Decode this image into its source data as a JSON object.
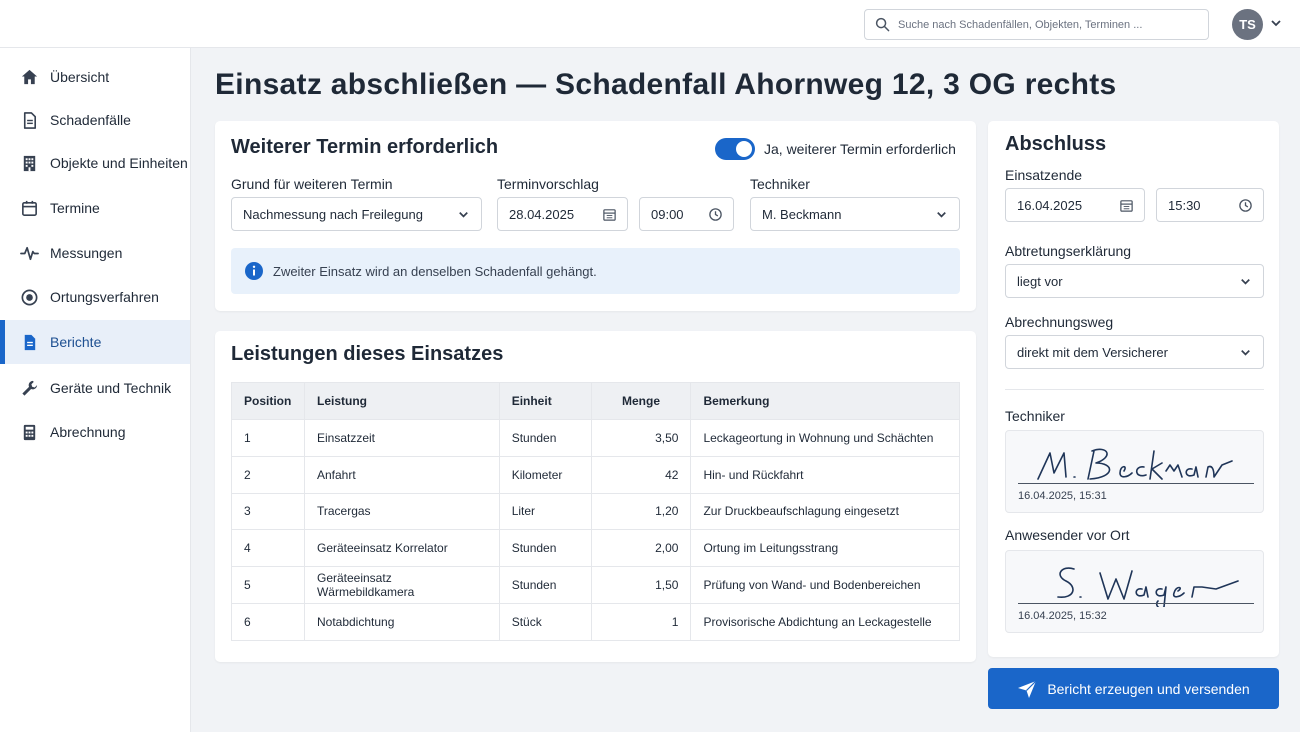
{
  "header": {
    "search_placeholder": "Suche nach Schadenfällen, Objekten, Terminen ...",
    "avatar_initials": "TS"
  },
  "sidebar": {
    "items": [
      {
        "label": "Übersicht",
        "icon": "home-icon"
      },
      {
        "label": "Schadenfälle",
        "icon": "document-icon"
      },
      {
        "label": "Objekte und Einheiten",
        "icon": "building-icon"
      },
      {
        "label": "Termine",
        "icon": "calendar-icon"
      },
      {
        "label": "Messungen",
        "icon": "activity-icon"
      },
      {
        "label": "Ortungsverfahren",
        "icon": "target-icon"
      },
      {
        "label": "Berichte",
        "icon": "report-icon",
        "active": true
      },
      {
        "label": "Geräte und Technik",
        "icon": "wrench-icon"
      },
      {
        "label": "Abrechnung",
        "icon": "calculator-icon"
      }
    ]
  },
  "page": {
    "title": "Einsatz abschließen — Schadenfall Ahornweg 12, 3 OG rechts"
  },
  "followup": {
    "title": "Weiterer Termin erforderlich",
    "toggle_label": "Ja, weiterer Termin erforderlich",
    "toggle_on": true,
    "reason_label": "Grund für weiteren Termin",
    "reason_value": "Nachmessung nach Freilegung",
    "date_label": "Terminvorschlag",
    "date_value": "28.04.2025",
    "time_value": "09:00",
    "technician_label": "Techniker",
    "technician_value": "M. Beckmann",
    "info_text": "Zweiter Einsatz wird an denselben Schadenfall gehängt."
  },
  "services": {
    "title": "Leistungen dieses Einsatzes",
    "columns": [
      "Position",
      "Leistung",
      "Einheit",
      "Menge",
      "Bemerkung"
    ],
    "rows": [
      [
        "1",
        "Einsatzzeit",
        "Stunden",
        "3,50",
        "Leckageortung in Wohnung und Schächten"
      ],
      [
        "2",
        "Anfahrt",
        "Kilometer",
        "42",
        "Hin- und Rückfahrt"
      ],
      [
        "3",
        "Tracergas",
        "Liter",
        "1,20",
        "Zur Druckbeaufschlagung eingesetzt"
      ],
      [
        "4",
        "Geräteeinsatz Korrelator",
        "Stunden",
        "2,00",
        "Ortung im Leitungsstrang"
      ],
      [
        "5",
        "Geräteeinsatz Wärmebildkamera",
        "Stunden",
        "1,50",
        "Prüfung von Wand- und Bodenbereichen"
      ],
      [
        "6",
        "Notabdichtung",
        "Stück",
        "1",
        "Provisorische Abdichtung an Leckagestelle"
      ]
    ]
  },
  "closing": {
    "title": "Abschluss",
    "end_label": "Einsatzende",
    "end_date": "16.04.2025",
    "end_time": "15:30",
    "assignment_label": "Abtretungserklärung",
    "assignment_value": "liegt vor",
    "billing_label": "Abrechnungsweg",
    "billing_value": "direkt mit dem Versicherer",
    "technician_sig_label": "Techniker",
    "technician_sig_time": "16.04.2025, 15:31",
    "onsite_sig_label": "Anwesender vor Ort",
    "onsite_sig_time": "16.04.2025, 15:32"
  },
  "actions": {
    "submit_label": "Bericht erzeugen und versenden"
  },
  "colors": {
    "accent": "#1a66c9",
    "sidebar_active_bg": "#e8eff9",
    "info_bg": "#e8f1fb"
  }
}
